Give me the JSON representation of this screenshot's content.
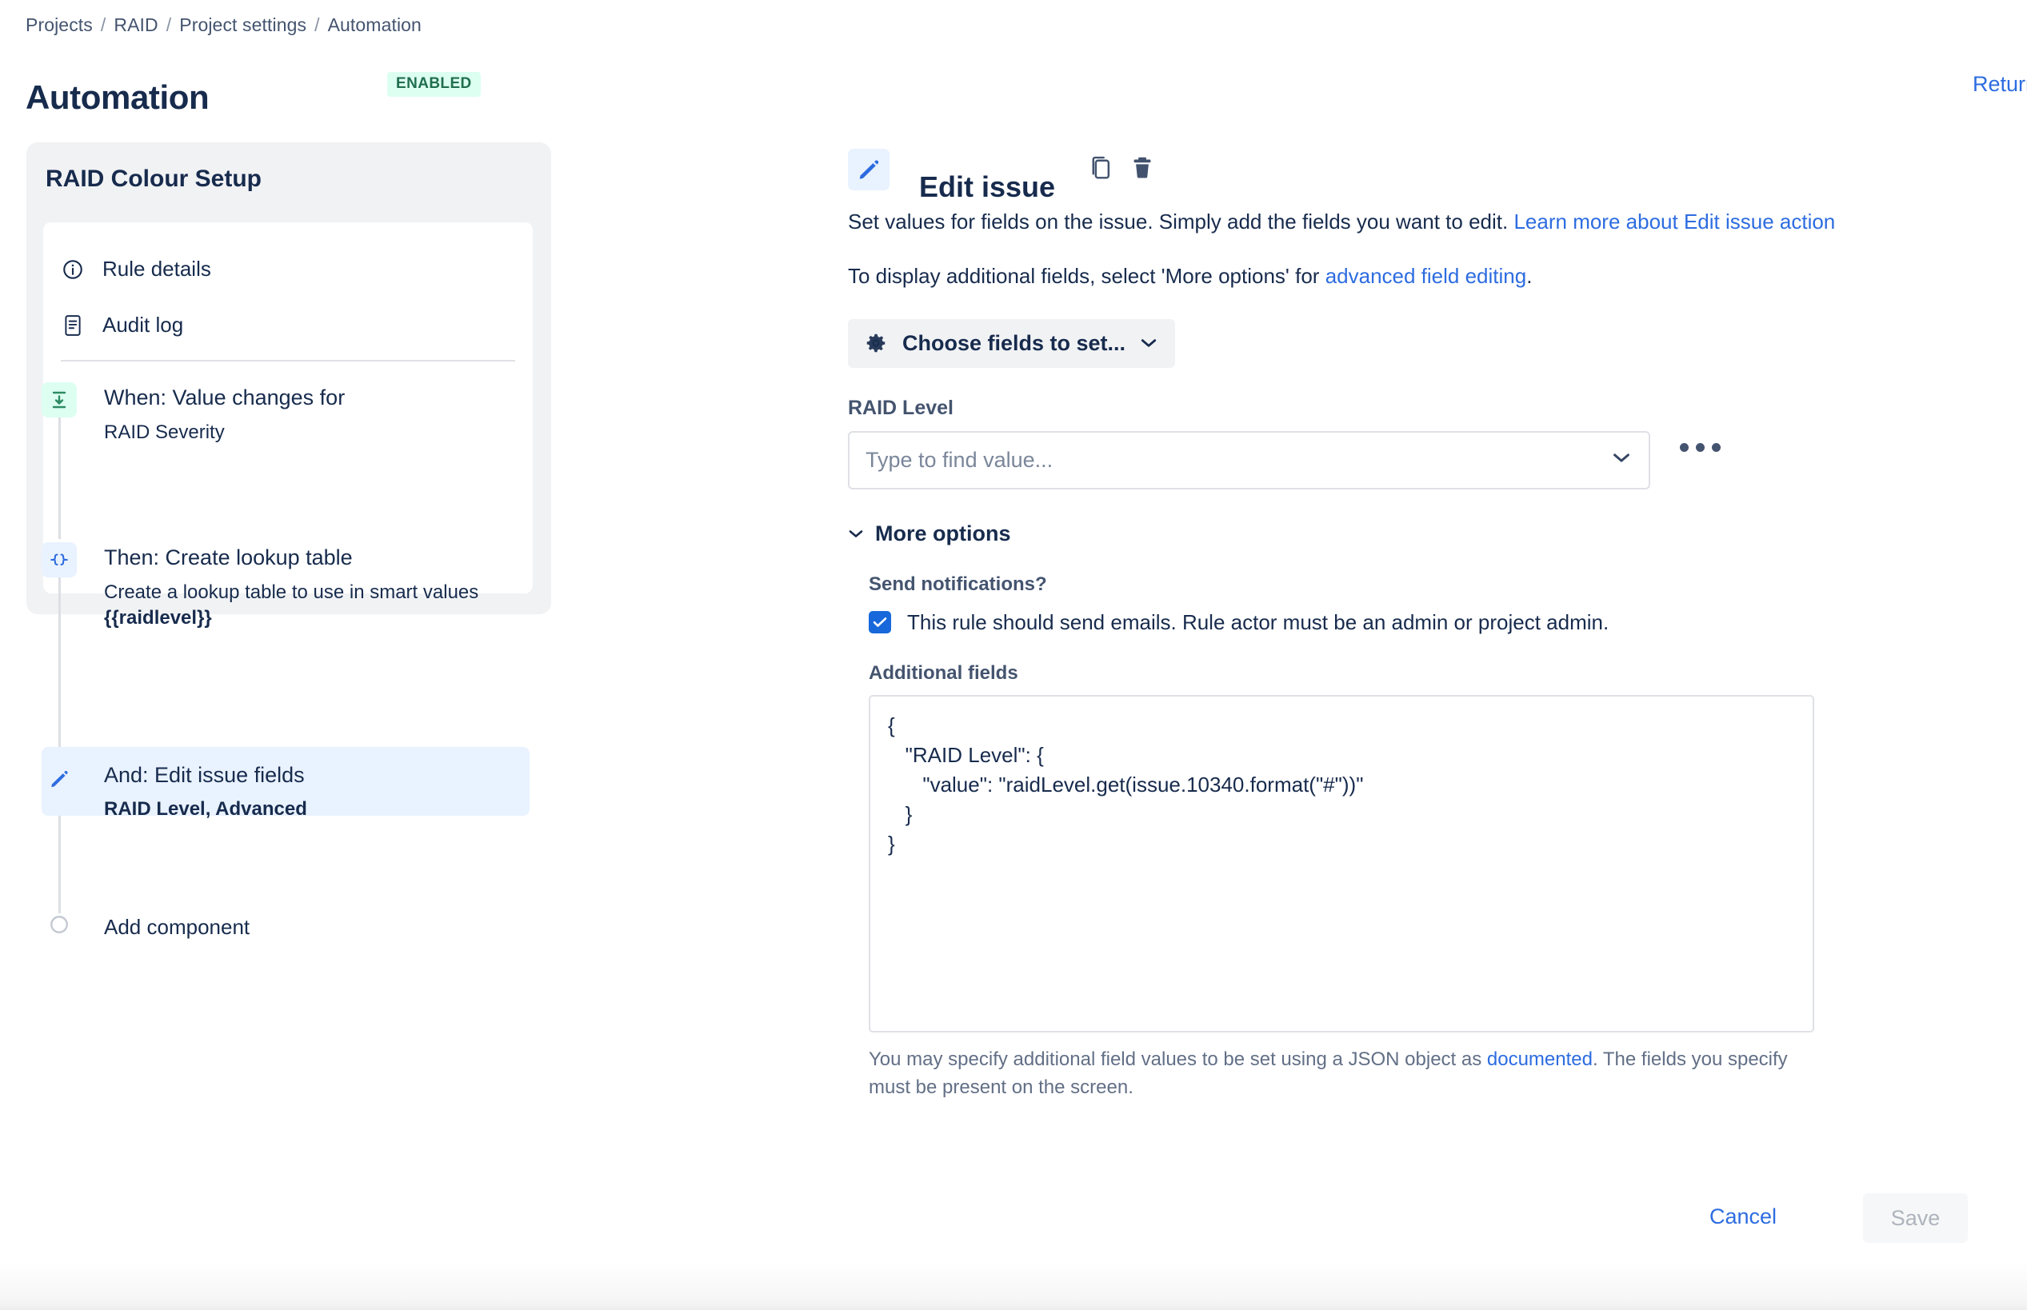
{
  "breadcrumb": {
    "items": [
      {
        "label": "Projects"
      },
      {
        "label": "RAID"
      },
      {
        "label": "Project settings"
      },
      {
        "label": "Automation"
      }
    ],
    "separator": "/"
  },
  "header": {
    "title": "Automation",
    "status_badge": "ENABLED",
    "return_link": "Return",
    "badge_bg": "#dcfff1",
    "badge_color": "#216e4e"
  },
  "rule_panel": {
    "title": "RAID Colour Setup",
    "nav": [
      {
        "label": "Rule details",
        "icon": "info-circle-icon"
      },
      {
        "label": "Audit log",
        "icon": "document-list-icon"
      }
    ],
    "components": [
      {
        "title": "When: Value changes for",
        "subtitle": "RAID Severity",
        "icon": "trigger-arrow-icon",
        "badge_color": "#dcfff1",
        "selected": false
      },
      {
        "title": "Then: Create lookup table",
        "subtitle": "Create a lookup table to use in smart values",
        "subtitle_bold": "{{raidlevel}}",
        "icon": "curly-braces-icon",
        "badge_color": "#e9f2ff",
        "selected": false
      },
      {
        "title": "And: Edit issue fields",
        "subtitle_bold": "RAID Level, Advanced",
        "icon": "pencil-icon",
        "badge_color": "#e9f2ff",
        "selected": true
      }
    ],
    "add_component": "Add component"
  },
  "detail": {
    "title": "Edit issue",
    "icons": {
      "action": "pencil-icon",
      "duplicate": "copy-icon",
      "delete": "trash-icon"
    },
    "description_1": "Set values for fields on the issue. Simply add the fields you want to edit. ",
    "description_1_link": "Learn more about Edit issue action",
    "description_2_before": "To display additional fields, select 'More options' for ",
    "description_2_link": "advanced field editing",
    "description_2_after": ".",
    "choose_fields_button": "Choose fields to set...",
    "choose_fields_icon": "gear-icon",
    "raid_level": {
      "label": "RAID Level",
      "placeholder": "Type to find value...",
      "value": "",
      "chevron_icon": "chevron-down-icon",
      "more_icon": "ellipsis-icon"
    },
    "more_options": {
      "label": "More options",
      "chevron_icon": "chevron-down-icon",
      "send_notifications_label": "Send notifications?",
      "send_emails_checkbox_label": "This rule should send emails. Rule actor must be an admin or project admin.",
      "send_emails_checked": true,
      "additional_fields_label": "Additional fields",
      "additional_fields_value": "{\n   \"RAID Level\": {\n      \"value\": \"raidLevel.get(issue.10340.format(\"#\"))\"\n   }\n}",
      "help_before": "You may specify additional field values to be set using a JSON object as ",
      "help_link": "documented",
      "help_after": ". The fields you specify must be present on the screen."
    }
  },
  "actions": {
    "cancel_label": "Cancel",
    "save_label": "Save",
    "save_disabled": true
  },
  "colors": {
    "link": "#2d6ce0",
    "accent": "#1868db",
    "text": "#172b4d",
    "muted": "#626f86"
  }
}
